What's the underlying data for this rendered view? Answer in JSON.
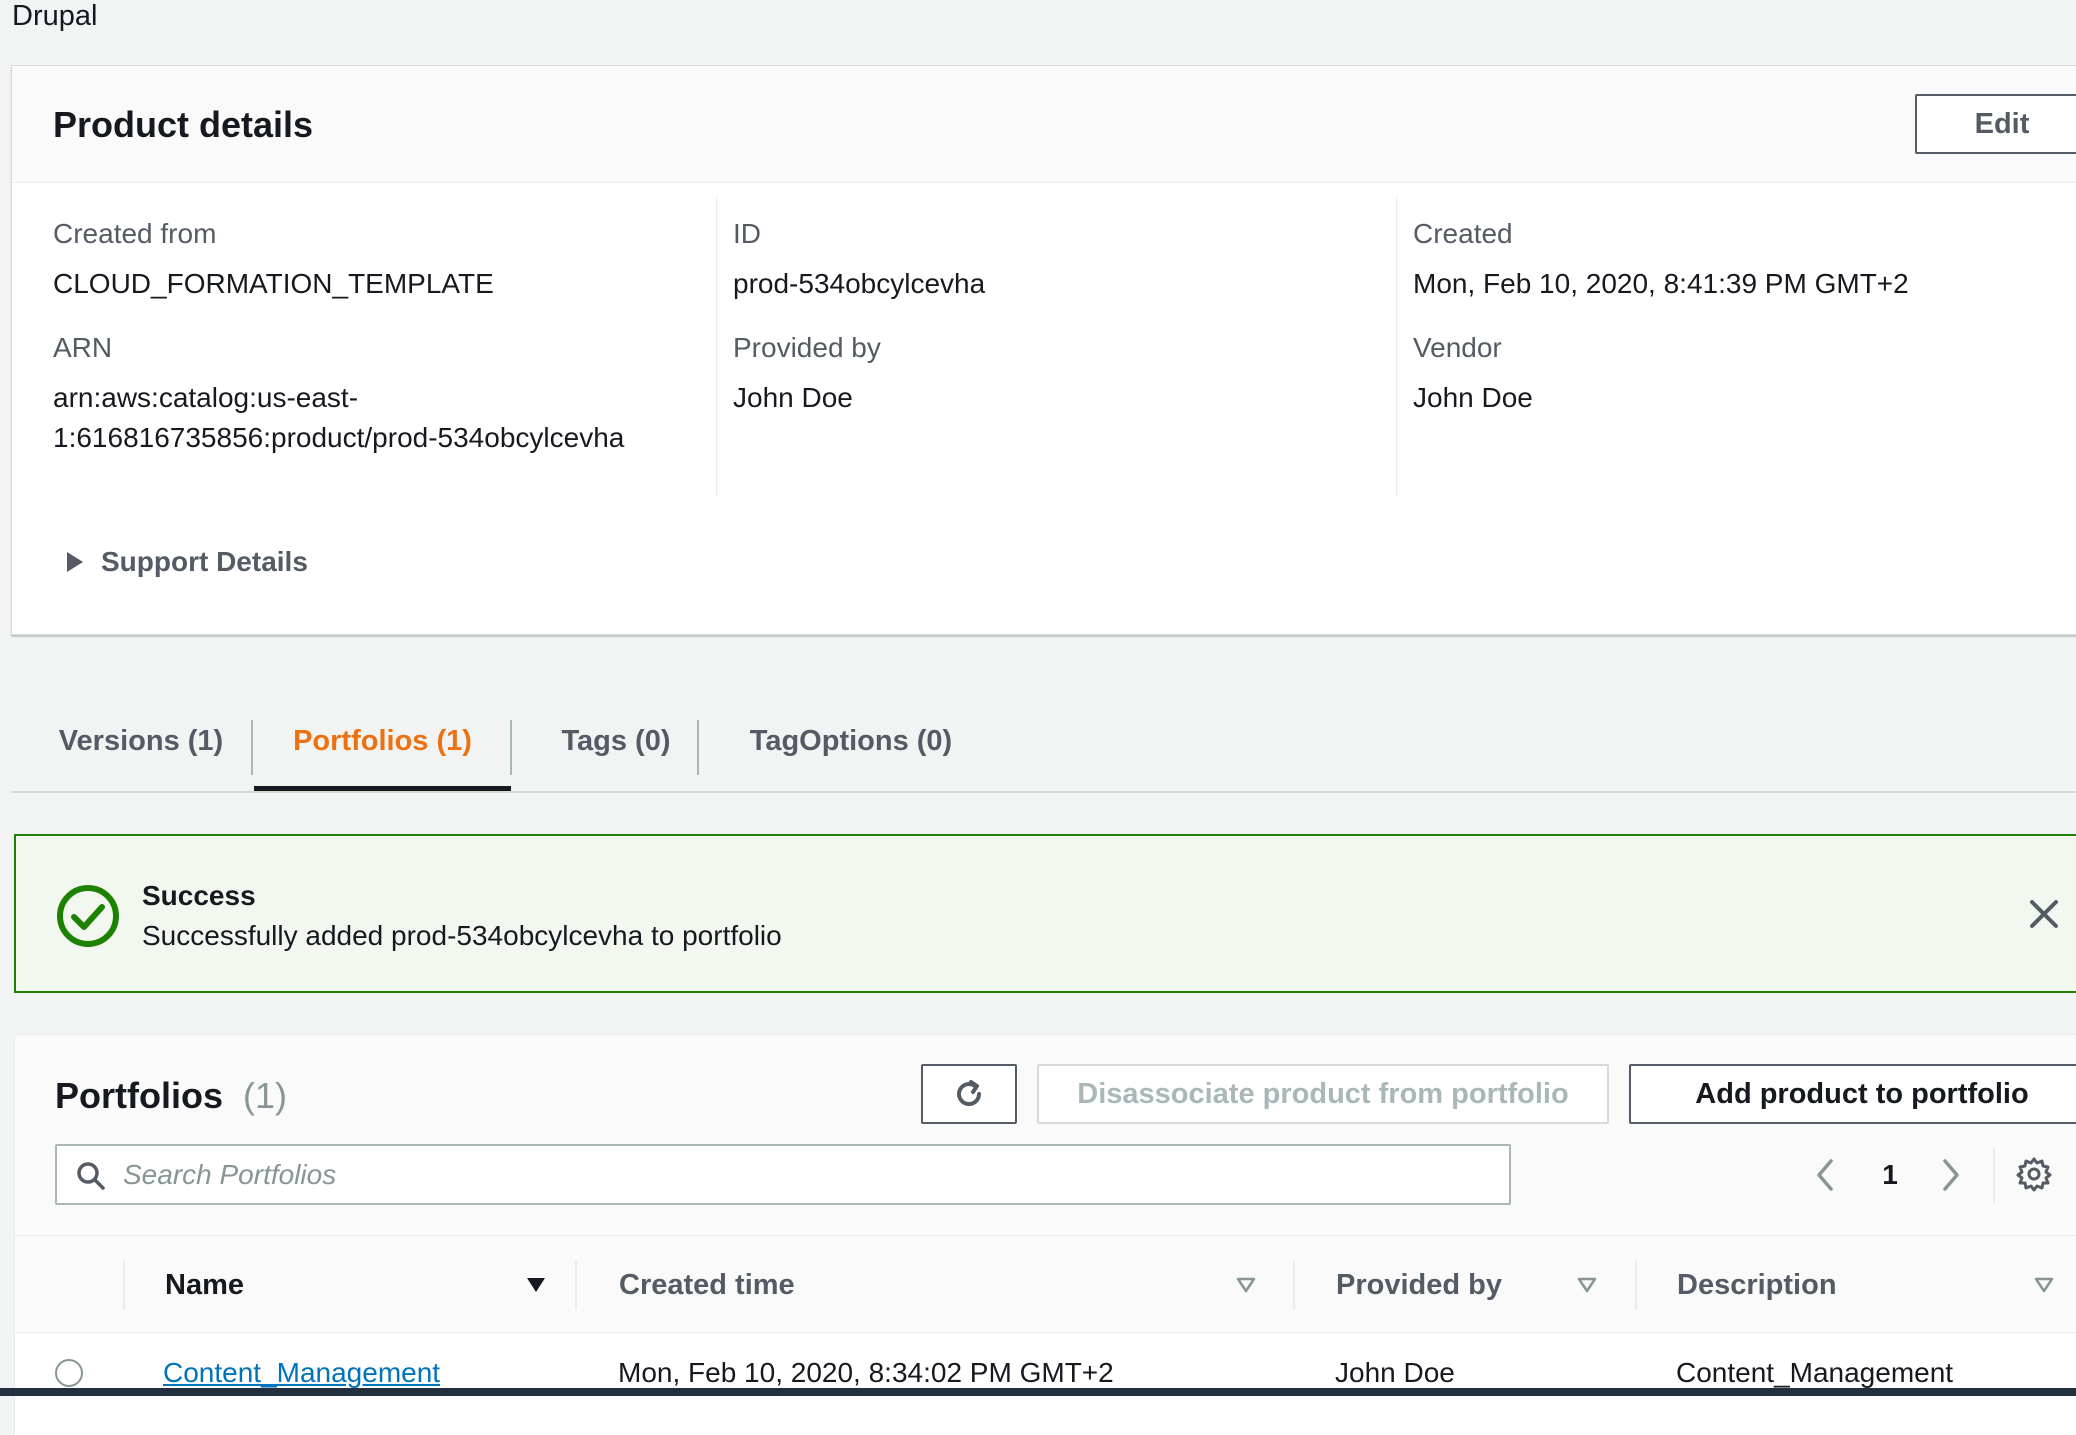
{
  "page": {
    "title": "Drupal"
  },
  "details": {
    "title": "Product details",
    "edit_label": "Edit",
    "created_from_label": "Created from",
    "created_from_value": "CLOUD_FORMATION_TEMPLATE",
    "arn_label": "ARN",
    "arn_line1": "arn:aws:catalog:us-east-",
    "arn_line2": "1:616816735856:product/prod-534obcylcevha",
    "id_label": "ID",
    "id_value": "prod-534obcylcevha",
    "provided_by_label": "Provided by",
    "provided_by_value": "John Doe",
    "created_label": "Created",
    "created_value": "Mon, Feb 10, 2020, 8:41:39 PM GMT+2",
    "vendor_label": "Vendor",
    "vendor_value": "John Doe",
    "support_label": "Support Details"
  },
  "tabs": [
    {
      "label": "Versions (1)",
      "active": false
    },
    {
      "label": "Portfolios (1)",
      "active": true
    },
    {
      "label": "Tags (0)",
      "active": false
    },
    {
      "label": "TagOptions (0)",
      "active": false
    }
  ],
  "flash": {
    "title": "Success",
    "message": "Successfully added prod-534obcylcevha to portfolio",
    "color": "#1d8102"
  },
  "portfolios": {
    "title": "Portfolios",
    "count": "(1)",
    "disassociate_label": "Disassociate product from portfolio",
    "add_label": "Add product to portfolio",
    "search_placeholder": "Search Portfolios",
    "page_number": "1",
    "columns": [
      "Name",
      "Created time",
      "Provided by",
      "Description"
    ],
    "rows": [
      {
        "name": "Content_Management",
        "created_time": "Mon, Feb 10, 2020, 8:34:02 PM GMT+2",
        "provided_by": "John Doe",
        "description": "Content_Management"
      }
    ]
  },
  "colors": {
    "accent": "#ec7211",
    "link": "#0073bb",
    "success": "#1d8102"
  }
}
